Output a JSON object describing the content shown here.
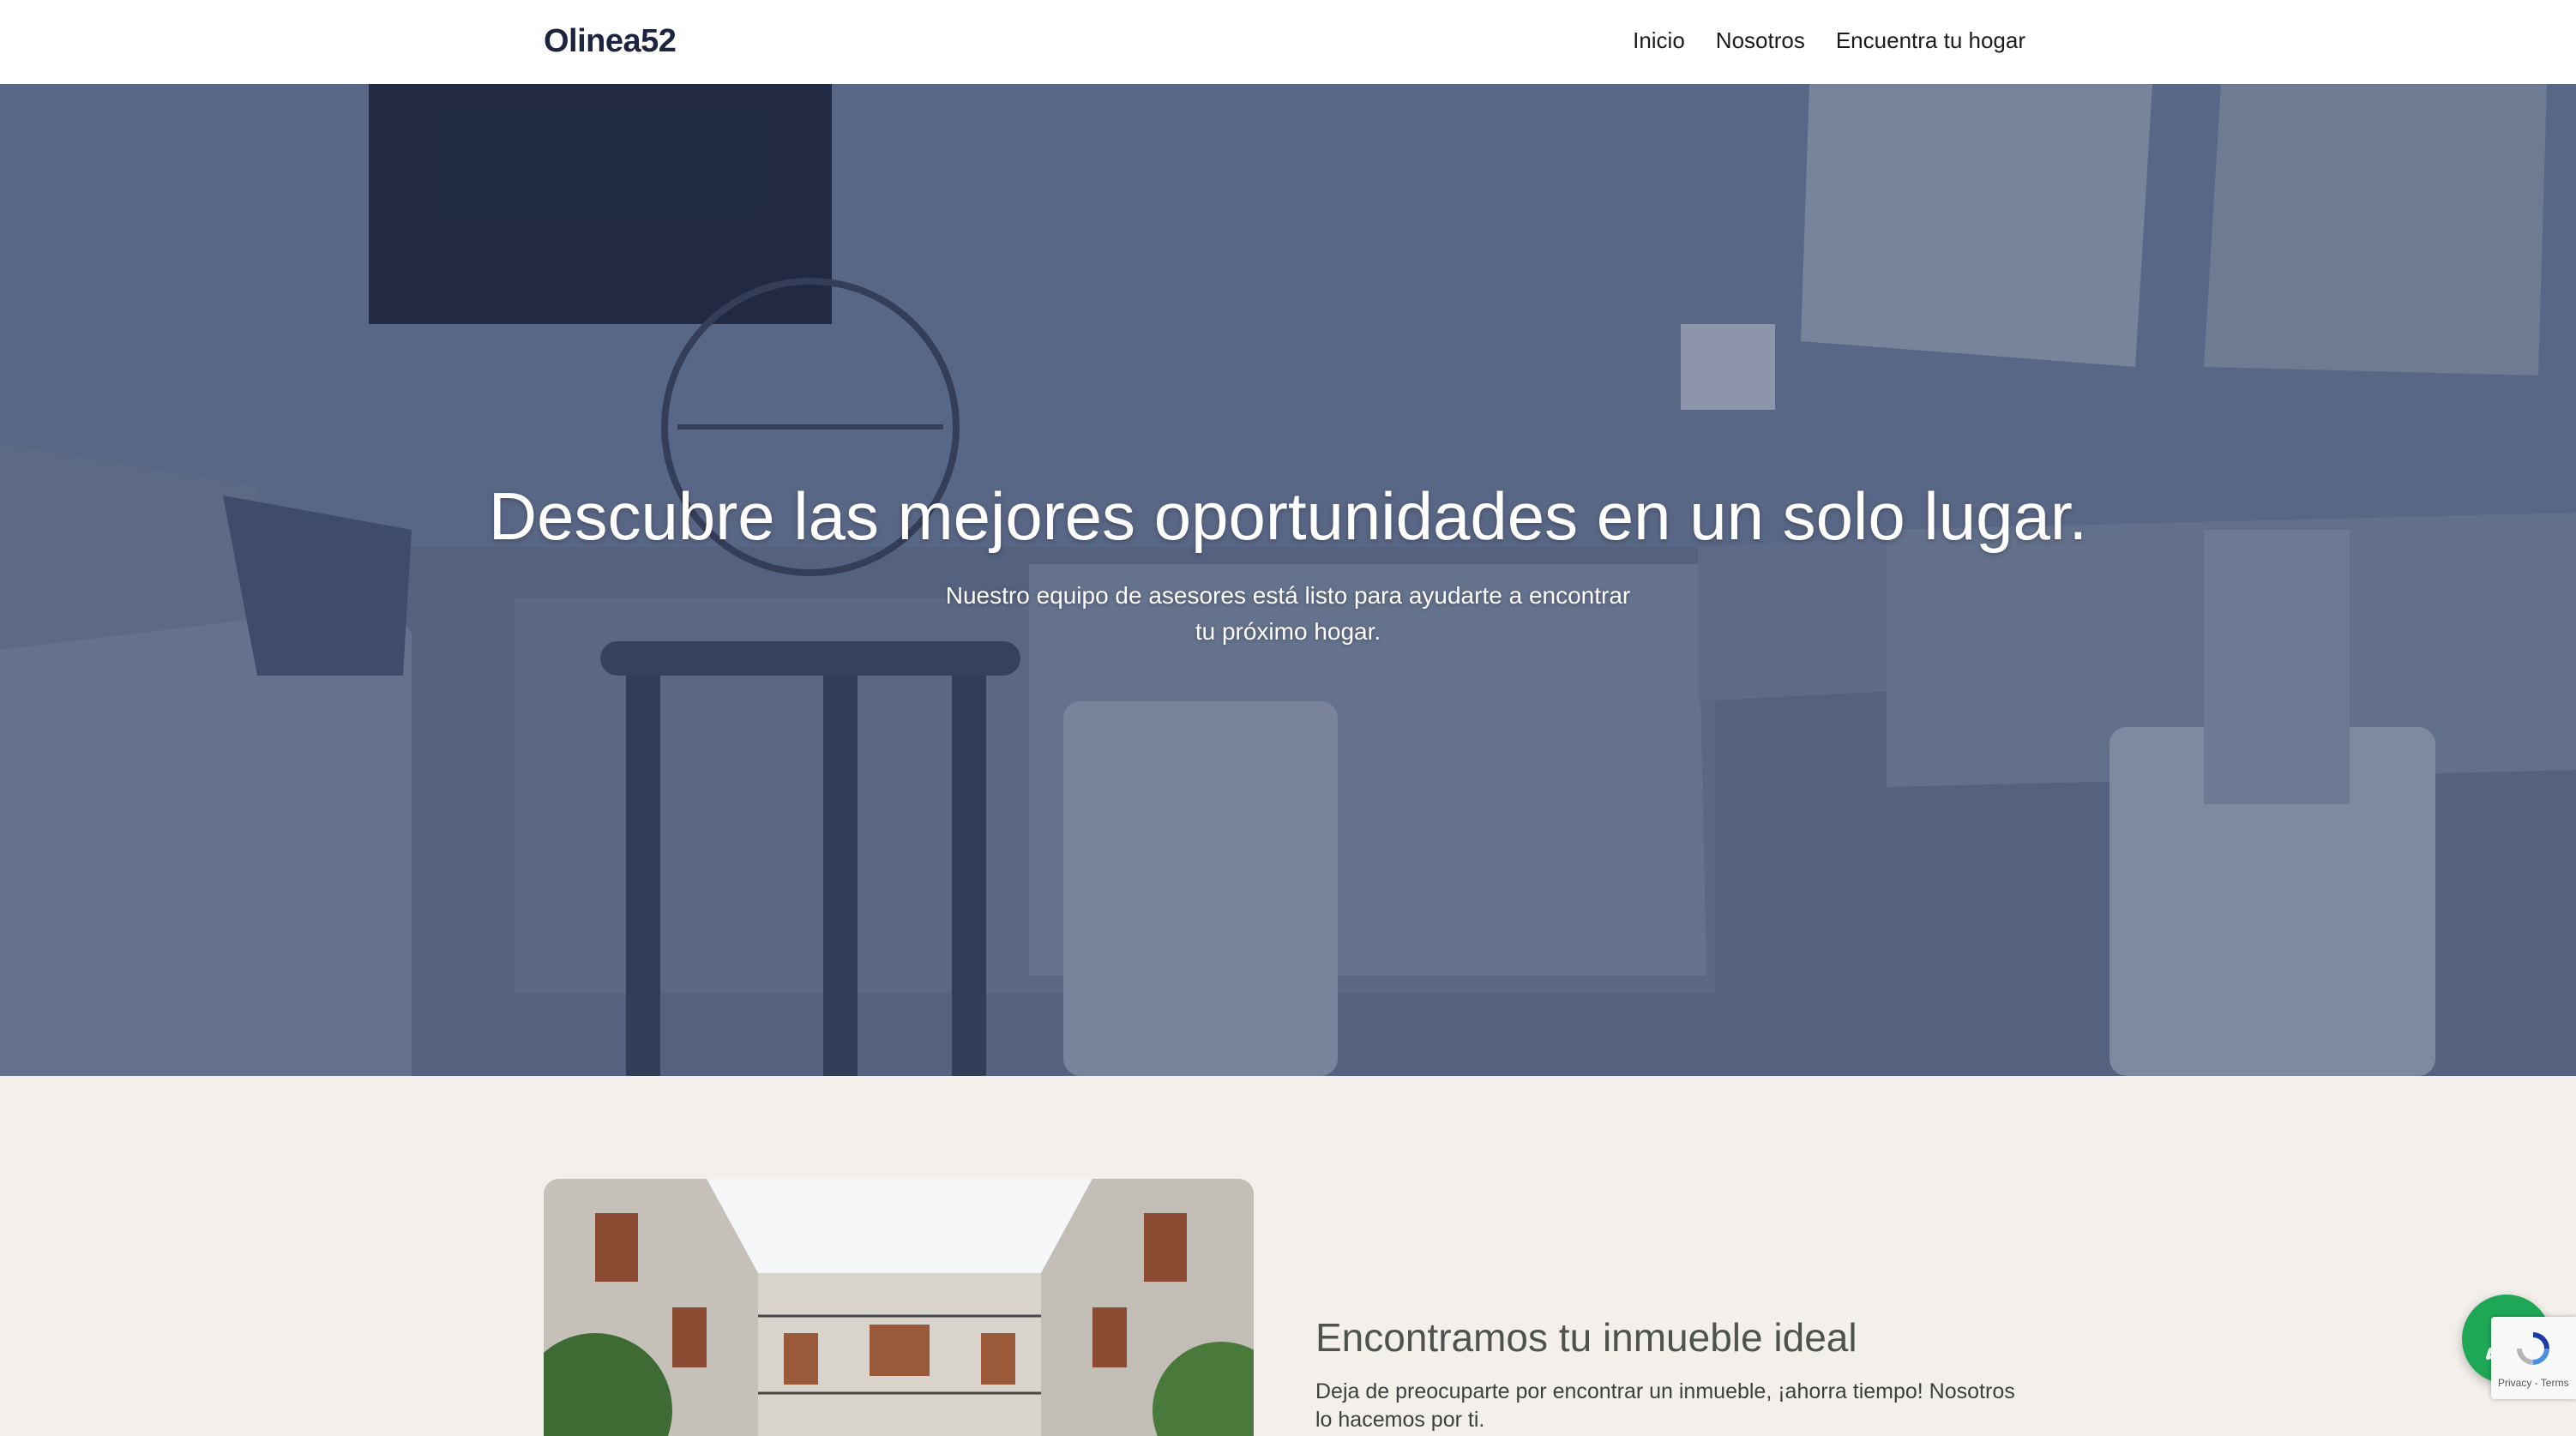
{
  "header": {
    "brand": "Olinea52",
    "nav": [
      {
        "label": "Inicio"
      },
      {
        "label": "Nosotros"
      },
      {
        "label": "Encuentra tu hogar"
      }
    ]
  },
  "hero": {
    "title": "Descubre las mejores oportunidades en un solo lugar.",
    "subtitle": "Nuestro equipo de asesores está listo para ayudarte a encontrar tu próximo hogar."
  },
  "feature": {
    "title": "Encontramos tu inmueble ideal",
    "text": "Deja de preocuparte por encontrar un inmueble, ¡ahorra tiempo! Nosotros lo hacemos por ti."
  },
  "recaptcha": {
    "privacy": "Privacy",
    "separator": " - ",
    "terms": "Terms"
  },
  "colors": {
    "brand": "#1c2440",
    "hero_overlay": "#2a385c",
    "section_bg": "#f3f0ec",
    "whatsapp": "#1ea855"
  },
  "icons": {
    "whatsapp": "whatsapp-icon",
    "recaptcha": "recaptcha-icon"
  }
}
